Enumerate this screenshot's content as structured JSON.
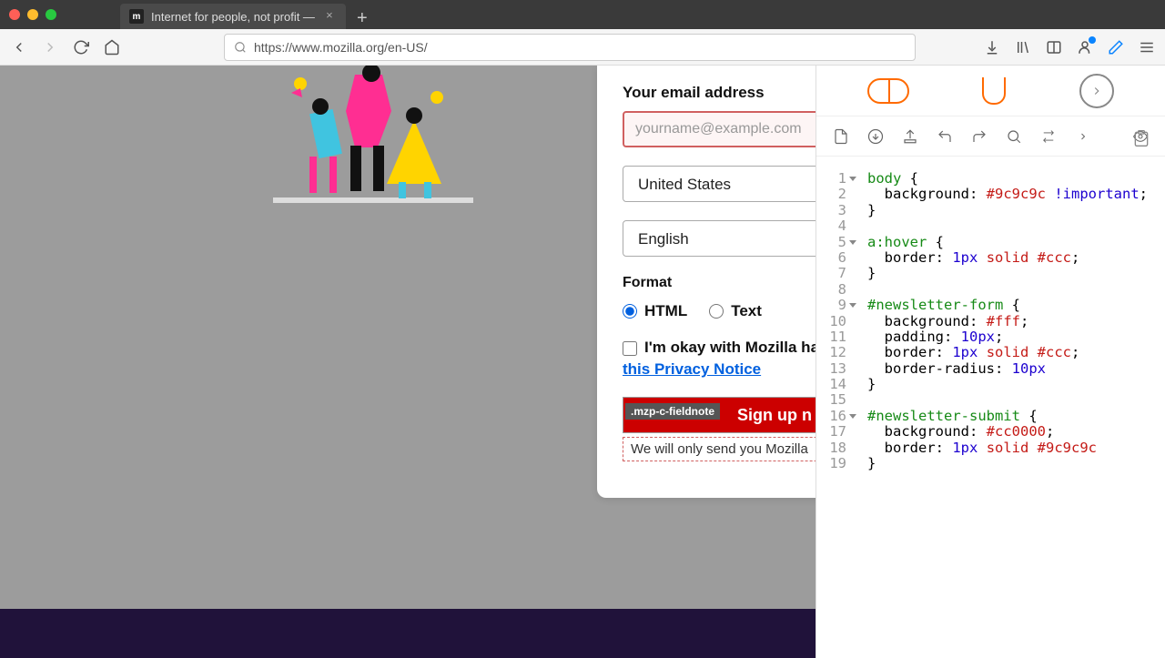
{
  "window": {
    "tab_title": "Internet for people, not profit —",
    "favicon_letter": "m"
  },
  "urlbar": {
    "url": "https://www.mozilla.org/en-US/"
  },
  "newsletter": {
    "email_label": "Your email address",
    "email_placeholder": "yourname@example.com",
    "country": "United States",
    "language": "English",
    "format_label": "Format",
    "radio_html": "HTML",
    "radio_text": "Text",
    "consent": "I'm okay with Mozilla handling",
    "privacy_link": "this Privacy Notice",
    "submit": "Sign up n",
    "tag": ".mzp-c-fieldnote",
    "fieldnote": "We will only send you Mozilla"
  },
  "editor": {
    "lines": [
      {
        "n": 1,
        "fold": true,
        "seg": [
          [
            "tok-sel",
            "body "
          ],
          [
            "tok-brace",
            "{"
          ]
        ]
      },
      {
        "n": 2,
        "fold": false,
        "seg": [
          [
            "",
            "  "
          ],
          [
            "tok-prop",
            "background"
          ],
          [
            "",
            ": "
          ],
          [
            "tok-val",
            "#9c9c9c"
          ],
          [
            "",
            " "
          ],
          [
            "tok-imp",
            "!important"
          ],
          [
            "",
            ";"
          ]
        ]
      },
      {
        "n": 3,
        "fold": false,
        "seg": [
          [
            "tok-brace",
            "}"
          ]
        ]
      },
      {
        "n": 4,
        "fold": false,
        "seg": [
          [
            "",
            ""
          ]
        ]
      },
      {
        "n": 5,
        "fold": true,
        "seg": [
          [
            "tok-sel",
            "a"
          ],
          [
            "tok-pseudo",
            ":hover "
          ],
          [
            "tok-brace",
            "{"
          ]
        ]
      },
      {
        "n": 6,
        "fold": false,
        "seg": [
          [
            "",
            "  "
          ],
          [
            "tok-prop",
            "border"
          ],
          [
            "",
            ": "
          ],
          [
            "tok-num",
            "1px"
          ],
          [
            "",
            " "
          ],
          [
            "tok-val",
            "solid #ccc"
          ],
          [
            "",
            ";"
          ]
        ]
      },
      {
        "n": 7,
        "fold": false,
        "seg": [
          [
            "tok-brace",
            "}"
          ]
        ]
      },
      {
        "n": 8,
        "fold": false,
        "seg": [
          [
            "",
            ""
          ]
        ]
      },
      {
        "n": 9,
        "fold": true,
        "seg": [
          [
            "tok-sel",
            "#newsletter-form "
          ],
          [
            "tok-brace",
            "{"
          ]
        ]
      },
      {
        "n": 10,
        "fold": false,
        "seg": [
          [
            "",
            "  "
          ],
          [
            "tok-prop",
            "background"
          ],
          [
            "",
            ": "
          ],
          [
            "tok-val",
            "#fff"
          ],
          [
            "",
            ";"
          ]
        ]
      },
      {
        "n": 11,
        "fold": false,
        "seg": [
          [
            "",
            "  "
          ],
          [
            "tok-prop",
            "padding"
          ],
          [
            "",
            ": "
          ],
          [
            "tok-num",
            "10px"
          ],
          [
            "",
            ";"
          ]
        ]
      },
      {
        "n": 12,
        "fold": false,
        "seg": [
          [
            "",
            "  "
          ],
          [
            "tok-prop",
            "border"
          ],
          [
            "",
            ": "
          ],
          [
            "tok-num",
            "1px"
          ],
          [
            "",
            " "
          ],
          [
            "tok-val",
            "solid #ccc"
          ],
          [
            "",
            ";"
          ]
        ]
      },
      {
        "n": 13,
        "fold": false,
        "seg": [
          [
            "",
            "  "
          ],
          [
            "tok-prop",
            "border-radius"
          ],
          [
            "",
            ": "
          ],
          [
            "tok-num",
            "10px"
          ]
        ]
      },
      {
        "n": 14,
        "fold": false,
        "seg": [
          [
            "tok-brace",
            "}"
          ]
        ]
      },
      {
        "n": 15,
        "fold": false,
        "seg": [
          [
            "",
            ""
          ]
        ]
      },
      {
        "n": 16,
        "fold": true,
        "seg": [
          [
            "tok-sel",
            "#newsletter-submit "
          ],
          [
            "tok-brace",
            "{"
          ]
        ]
      },
      {
        "n": 17,
        "fold": false,
        "seg": [
          [
            "",
            "  "
          ],
          [
            "tok-prop",
            "background"
          ],
          [
            "",
            ": "
          ],
          [
            "tok-val",
            "#cc0000"
          ],
          [
            "",
            ";"
          ]
        ]
      },
      {
        "n": 18,
        "fold": false,
        "seg": [
          [
            "",
            "  "
          ],
          [
            "tok-prop",
            "border"
          ],
          [
            "",
            ": "
          ],
          [
            "tok-num",
            "1px"
          ],
          [
            "",
            " "
          ],
          [
            "tok-val",
            "solid #9c9c9c"
          ]
        ]
      },
      {
        "n": 19,
        "fold": false,
        "seg": [
          [
            "tok-brace",
            "}"
          ]
        ]
      }
    ]
  }
}
